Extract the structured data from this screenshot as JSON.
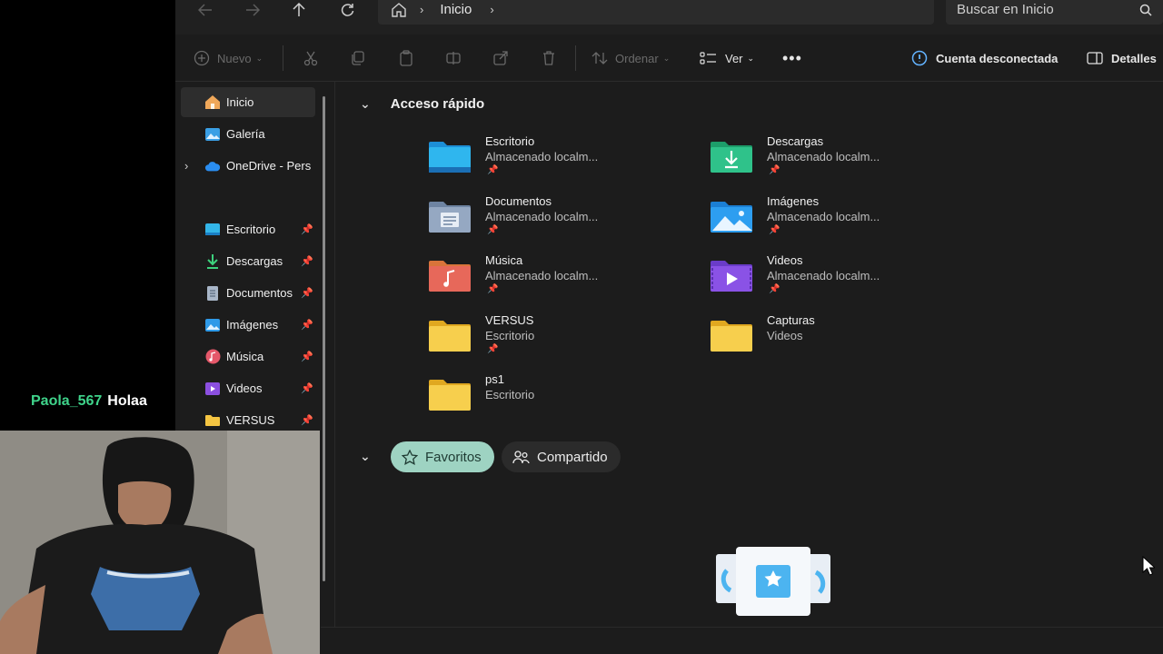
{
  "stream": {
    "chat_user": "Paola_567",
    "chat_message": "Holaa"
  },
  "address": {
    "location": "Inicio"
  },
  "search": {
    "placeholder": "Buscar en Inicio"
  },
  "toolbar": {
    "new_label": "Nuevo",
    "sort_label": "Ordenar",
    "view_label": "Ver",
    "account_label": "Cuenta desconectada",
    "details_label": "Detalles"
  },
  "sidebar": {
    "items": [
      {
        "label": "Inicio",
        "icon": "home-icon"
      },
      {
        "label": "Galería",
        "icon": "gallery-icon"
      },
      {
        "label": "OneDrive - Pers",
        "icon": "cloud-icon"
      },
      {
        "label": "Escritorio",
        "icon": "desktop-icon"
      },
      {
        "label": "Descargas",
        "icon": "download-icon"
      },
      {
        "label": "Documentos",
        "icon": "document-icon"
      },
      {
        "label": "Imágenes",
        "icon": "pictures-icon"
      },
      {
        "label": "Música",
        "icon": "music-icon"
      },
      {
        "label": "Videos",
        "icon": "video-icon"
      },
      {
        "label": "VERSUS",
        "icon": "folder-icon"
      }
    ]
  },
  "quick_access": {
    "title": "Acceso rápido",
    "tiles": [
      {
        "name": "Escritorio",
        "sub": "Almacenado localm...",
        "icon": "desktop-folder-icon",
        "pinned": true
      },
      {
        "name": "Descargas",
        "sub": "Almacenado localm...",
        "icon": "downloads-folder-icon",
        "pinned": true
      },
      {
        "name": "Documentos",
        "sub": "Almacenado localm...",
        "icon": "documents-folder-icon",
        "pinned": true
      },
      {
        "name": "Imágenes",
        "sub": "Almacenado localm...",
        "icon": "pictures-folder-icon",
        "pinned": true
      },
      {
        "name": "Música",
        "sub": "Almacenado localm...",
        "icon": "music-folder-icon",
        "pinned": true
      },
      {
        "name": "Videos",
        "sub": "Almacenado localm...",
        "icon": "videos-folder-icon",
        "pinned": true
      },
      {
        "name": "VERSUS",
        "sub": "Escritorio",
        "icon": "folder-icon",
        "pinned": true
      },
      {
        "name": "Capturas",
        "sub": "Videos",
        "icon": "folder-icon",
        "pinned": false
      },
      {
        "name": "ps1",
        "sub": "Escritorio",
        "icon": "folder-icon",
        "pinned": false
      }
    ]
  },
  "filters": {
    "favorites_label": "Favoritos",
    "shared_label": "Compartido"
  },
  "colors": {
    "accent_chip": "#9ed3c2",
    "window_bg": "#1c1c1c",
    "chat_user": "#3fd48b"
  }
}
